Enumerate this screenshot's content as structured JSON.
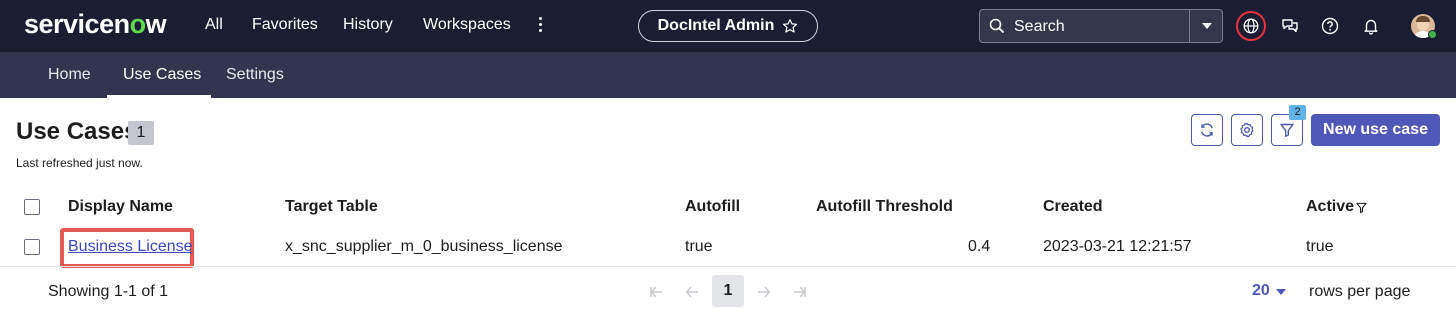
{
  "header": {
    "logo": {
      "part1": "servicen",
      "part2": "o",
      "part3": "w"
    },
    "nav": [
      "All",
      "Favorites",
      "History",
      "Workspaces"
    ],
    "app_name": "DocIntel Admin",
    "search_placeholder": "Search"
  },
  "subnav": {
    "tabs": [
      "Home",
      "Use Cases",
      "Settings"
    ],
    "active_tab": "Use Cases"
  },
  "page": {
    "title": "Use Cases",
    "count": "1",
    "refreshed": "Last refreshed just now.",
    "filter_count": "2",
    "new_button": "New use case"
  },
  "table": {
    "columns": [
      "Display Name",
      "Target Table",
      "Autofill",
      "Autofill Threshold",
      "Created",
      "Active"
    ],
    "rows": [
      {
        "display_name": "Business License",
        "target_table": "x_snc_supplier_m_0_business_license",
        "autofill": "true",
        "autofill_threshold": "0.4",
        "created": "2023-03-21 12:21:57",
        "active": "true"
      }
    ]
  },
  "footer": {
    "showing": "Showing 1-1 of 1",
    "current_page": "1",
    "per_page": "20",
    "rows_per_page_label": "rows per page"
  },
  "colors": {
    "header_bg": "#1b1e33",
    "subnav_bg": "#32354f",
    "accent": "#4e58b8",
    "highlight": "#e45a52",
    "logo_green": "#62d84e"
  }
}
